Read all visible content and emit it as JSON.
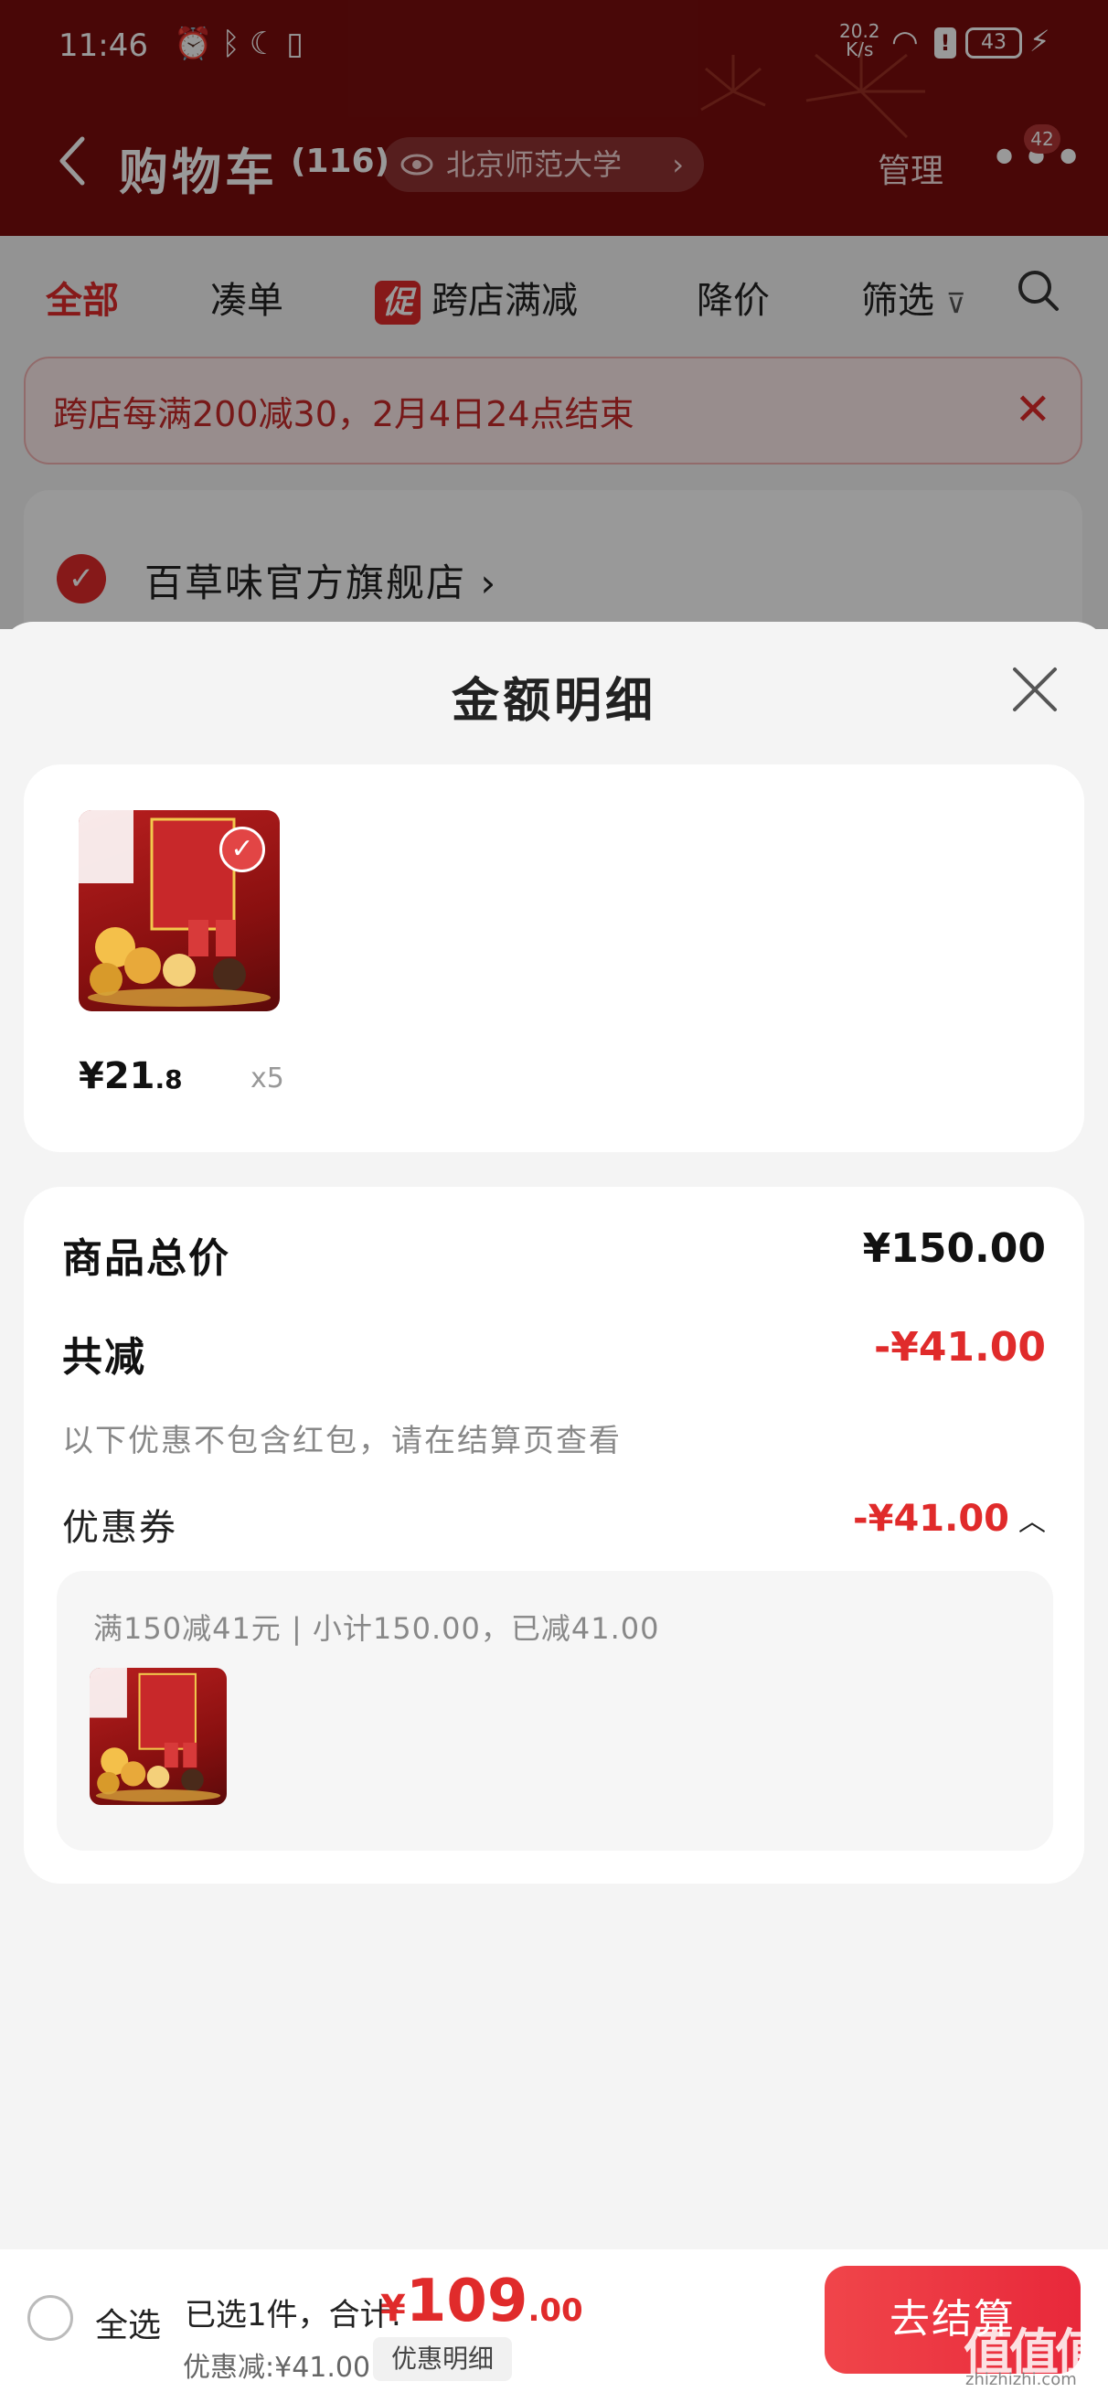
{
  "status_bar": {
    "time": "11:46",
    "net_speed": "20.2",
    "net_unit": "K/s",
    "battery": "43"
  },
  "header": {
    "title": "购物车",
    "count": "(116)",
    "location": "北京师范大学",
    "manage": "管理",
    "badge": "42"
  },
  "tabs": {
    "all": "全部",
    "bundle": "凑单",
    "promo_tag": "促",
    "cross_store": "跨店满减",
    "price_drop": "降价",
    "filter": "筛选"
  },
  "notice": {
    "text": "跨店每满200减30，2月4日24点结束"
  },
  "store": {
    "name": "百草味官方旗舰店"
  },
  "sheet": {
    "title": "金额明细",
    "item": {
      "price_int": "¥21",
      "price_dec": ".8",
      "qty": "x5"
    },
    "total_label": "商品总价",
    "total_value": "¥150.00",
    "discount_label": "共减",
    "discount_value": "-¥41.00",
    "discount_note": "以下优惠不包含红包，请在结算页查看",
    "coupon_label": "优惠券",
    "coupon_value": "-¥41.00",
    "coupon_desc": "满150减41元 | 小计150.00，已减41.00"
  },
  "checkout": {
    "select_all": "全选",
    "selected_text": "已选1件，合计:",
    "price_symbol": "¥",
    "price_int": "109",
    "price_dec": ".00",
    "discount_text": "优惠减:¥41.00",
    "detail_button": "优惠明细",
    "checkout_button": "去结算"
  },
  "watermark": {
    "logo": "值值值",
    "site": "zhizhizhi.com"
  },
  "colors": {
    "header_red": "#7a0d0d",
    "accent_red": "#e02b2b"
  }
}
